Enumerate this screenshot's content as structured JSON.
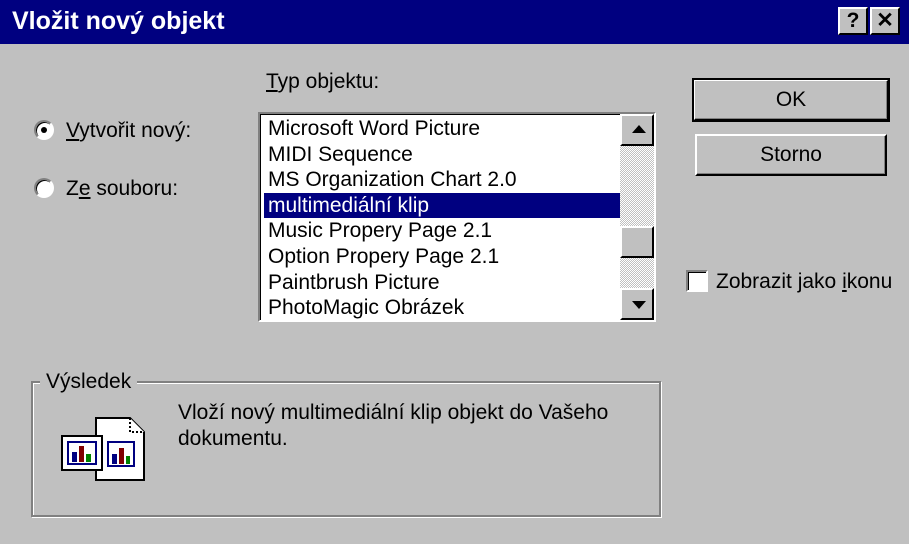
{
  "window": {
    "title": "Vložit nový objekt"
  },
  "title_buttons": {
    "help": "?",
    "close": "✕"
  },
  "options": {
    "create_new": {
      "label_prefix": "",
      "label_hotkey": "V",
      "label_rest": "ytvořit nový:",
      "selected": true
    },
    "from_file": {
      "label_prefix": "Z",
      "label_hotkey": "e",
      "label_rest": " souboru:",
      "selected": false
    }
  },
  "object_type": {
    "label_hotkey": "T",
    "label_rest": "yp objektu:",
    "items": [
      "Microsoft Word Picture",
      "MIDI Sequence",
      "MS Organization Chart 2.0",
      "multimediální klip",
      "Music Propery Page 2.1",
      "Option Propery Page 2.1",
      "Paintbrush Picture",
      "PhotoMagic Obrázek"
    ],
    "selected_index": 3
  },
  "buttons": {
    "ok": "OK",
    "cancel": "Storno"
  },
  "display_as_icon": {
    "label_prefix": "Zobrazit jako ",
    "label_hotkey": "i",
    "label_rest": "konu",
    "checked": false
  },
  "result": {
    "title": "Výsledek",
    "text": "Vloží nový multimediální klip objekt do Vašeho dokumentu."
  },
  "colors": {
    "face": "#c0c0c0",
    "titlebar": "#000080",
    "selection": "#000080"
  }
}
